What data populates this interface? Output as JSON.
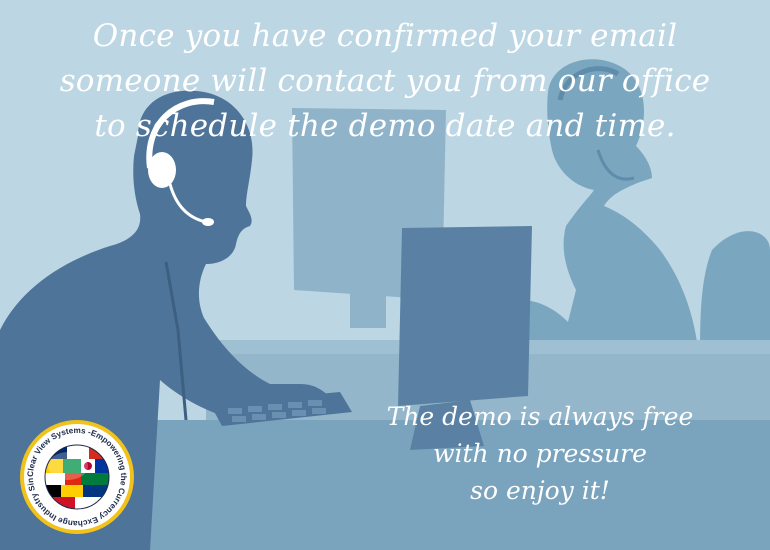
{
  "headline": {
    "line1": "Once you have confirmed your email",
    "line2": "someone will contact you from our office",
    "line3": "to schedule the demo date and time."
  },
  "subline": {
    "line1": "The demo is always free",
    "line2": "with no pressure",
    "line3": "so enjoy it!"
  },
  "logo": {
    "ring_text": "Clear View Systems -Empowering the Currency Exchange Industry Since 2013 -"
  },
  "colors": {
    "background": "#bcd6e3",
    "foreground_figure": "#4e7499",
    "background_figure": "#7aa3bd",
    "desk": "#93b6cb",
    "text": "#ffffff",
    "logo_ring": "#f1c21b"
  }
}
